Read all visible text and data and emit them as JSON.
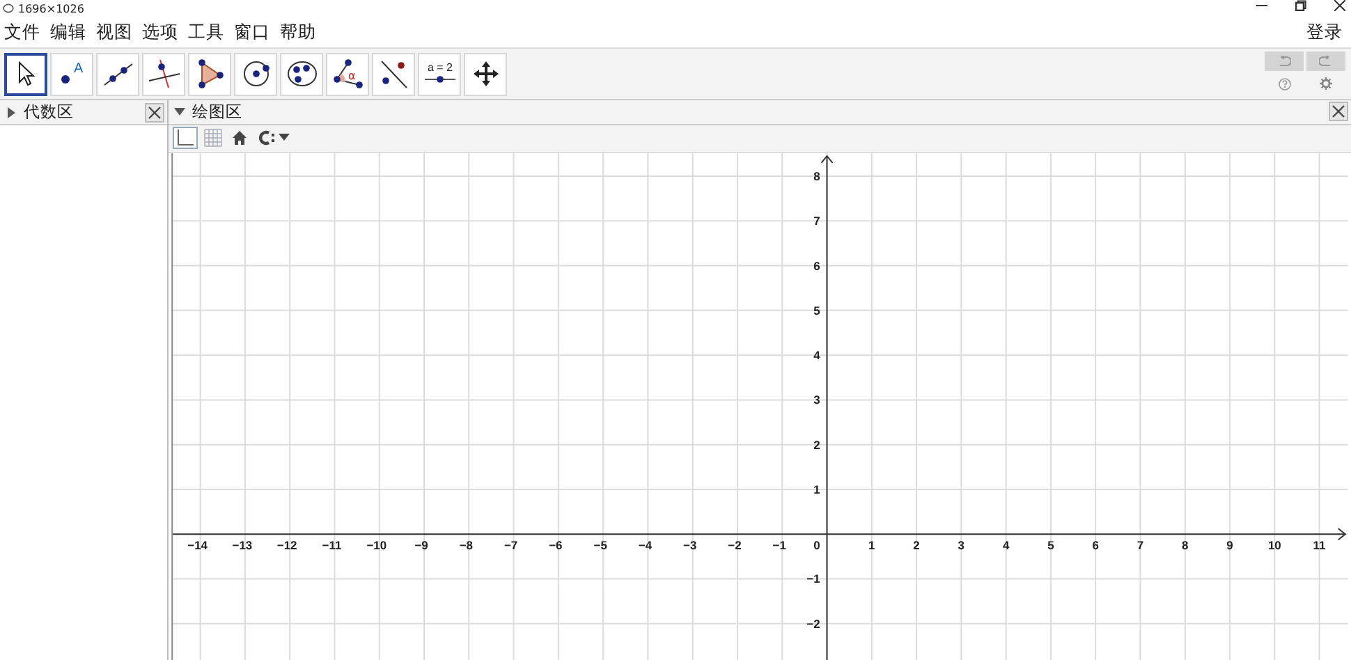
{
  "window": {
    "title": "1696×1026"
  },
  "menu": [
    "文件",
    "编辑",
    "视图",
    "选项",
    "工具",
    "窗口",
    "帮助"
  ],
  "login": "登录",
  "tools": [
    {
      "kind": "move",
      "selected": true
    },
    {
      "kind": "point",
      "label": "A",
      "selected": false
    },
    {
      "kind": "line",
      "selected": false
    },
    {
      "kind": "perpendicular",
      "selected": false
    },
    {
      "kind": "polygon",
      "selected": false
    },
    {
      "kind": "circle",
      "selected": false
    },
    {
      "kind": "conic",
      "selected": false
    },
    {
      "kind": "angle",
      "label": "α",
      "selected": false
    },
    {
      "kind": "reflect",
      "selected": false
    },
    {
      "kind": "slider",
      "label": "a = 2",
      "selected": false
    },
    {
      "kind": "pan",
      "selected": false
    }
  ],
  "history": {
    "undo_disabled": true,
    "redo_disabled": true
  },
  "algebra_panel": {
    "title": "代数区",
    "expanded": false
  },
  "graphics_panel": {
    "title": "绘图区",
    "expanded": true,
    "style_bar": [
      {
        "kind": "axes",
        "selected": true
      },
      {
        "kind": "grid",
        "selected": false
      },
      {
        "kind": "home"
      },
      {
        "kind": "capture"
      }
    ],
    "x_ticks_negative": [
      "−14",
      "−13",
      "−12",
      "−11",
      "−10",
      "−9",
      "−8",
      "−7",
      "−6",
      "−5",
      "−4",
      "−3",
      "−2",
      "−1"
    ],
    "origin_label": "0",
    "x_ticks_positive": [
      "1",
      "2",
      "3",
      "4",
      "5",
      "6",
      "7",
      "8",
      "9",
      "10",
      "11"
    ],
    "y_ticks_positive": [
      "8",
      "7",
      "6",
      "5",
      "4",
      "3",
      "2",
      "1"
    ],
    "y_ticks_negative": [
      "−1",
      "−2"
    ]
  }
}
